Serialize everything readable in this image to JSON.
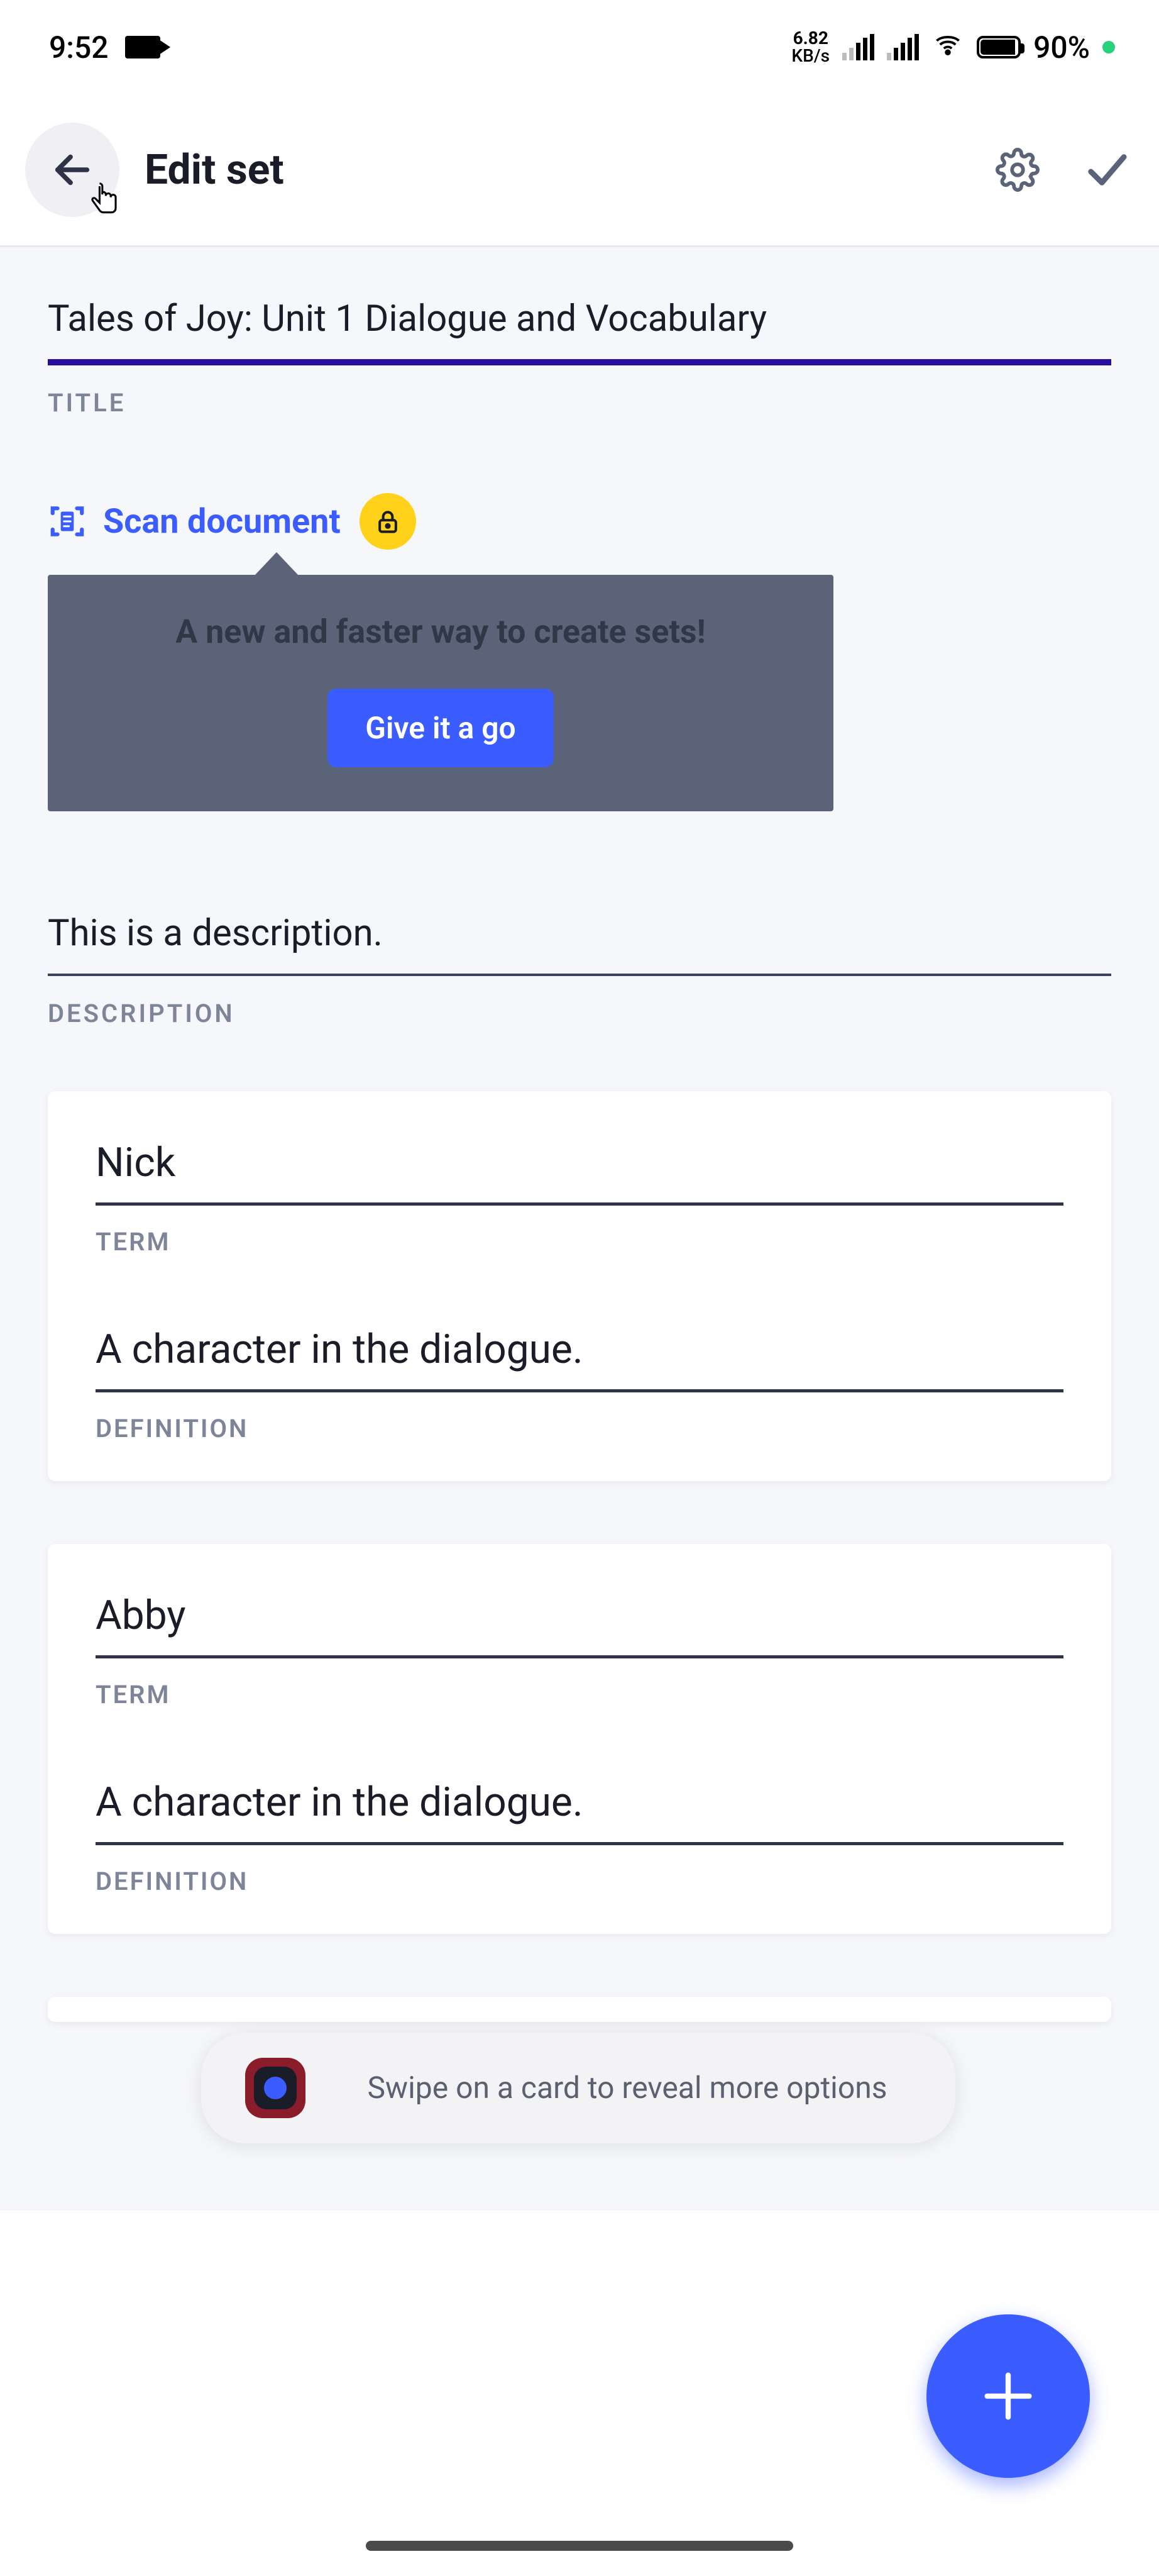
{
  "status": {
    "time": "9:52",
    "net_rate": "6.82",
    "net_unit": "KB/s",
    "battery_pct": "90%"
  },
  "header": {
    "title": "Edit set"
  },
  "set": {
    "title_value": "Tales of Joy: Unit 1 Dialogue and Vocabulary",
    "title_label": "TITLE",
    "description_value": "This is a description.",
    "description_label": "DESCRIPTION"
  },
  "scan": {
    "link_label": "Scan document"
  },
  "promo": {
    "text": "A new and faster way to create sets!",
    "cta": "Give it a go"
  },
  "cards": [
    {
      "term": "Nick",
      "term_label": "TERM",
      "definition": "A character in the dialogue.",
      "definition_label": "DEFINITION"
    },
    {
      "term": "Abby",
      "term_label": "TERM",
      "definition": "A character in the dialogue.",
      "definition_label": "DEFINITION"
    }
  ],
  "toast": {
    "text": "Swipe on a card to reveal more options"
  }
}
